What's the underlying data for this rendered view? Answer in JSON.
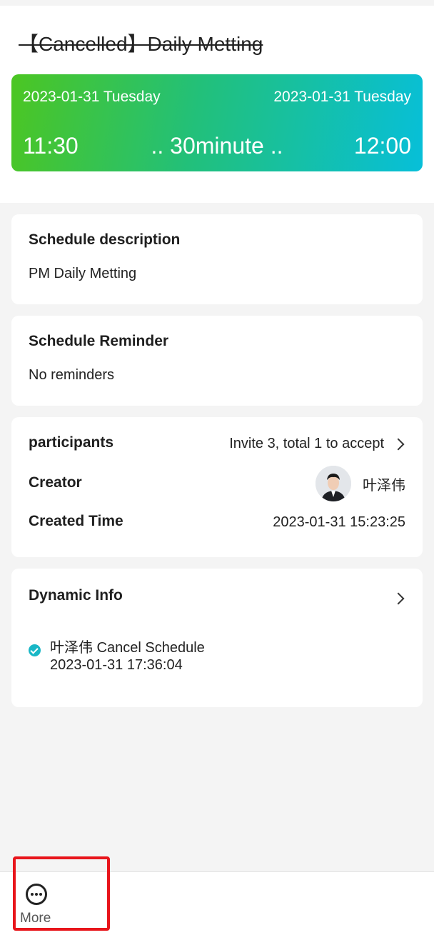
{
  "header": {
    "title": "【Cancelled】Daily Metting"
  },
  "time_card": {
    "start_date": "2023-01-31 Tuesday",
    "end_date": "2023-01-31 Tuesday",
    "start_time": "11:30",
    "duration": ".. 30minute ..",
    "end_time": "12:00",
    "gradient_start_color": "#4cc622",
    "gradient_end_color": "#07bfd9"
  },
  "description": {
    "heading": "Schedule description",
    "text": "PM Daily Metting"
  },
  "reminder": {
    "heading": "Schedule Reminder",
    "text": "No reminders"
  },
  "participants": {
    "heading": "participants",
    "summary": "Invite 3, total 1 to accept",
    "creator_label": "Creator",
    "creator_name": "叶泽伟",
    "created_time_label": "Created Time",
    "created_time": "2023-01-31 15:23:25"
  },
  "dynamic": {
    "heading": "Dynamic Info",
    "items": [
      {
        "text": "叶泽伟 Cancel Schedule",
        "time": "2023-01-31 17:36:04"
      }
    ],
    "status_color": "#19b7c6"
  },
  "bottom_bar": {
    "more_label": "More",
    "highlight_color": "#e8151b"
  }
}
